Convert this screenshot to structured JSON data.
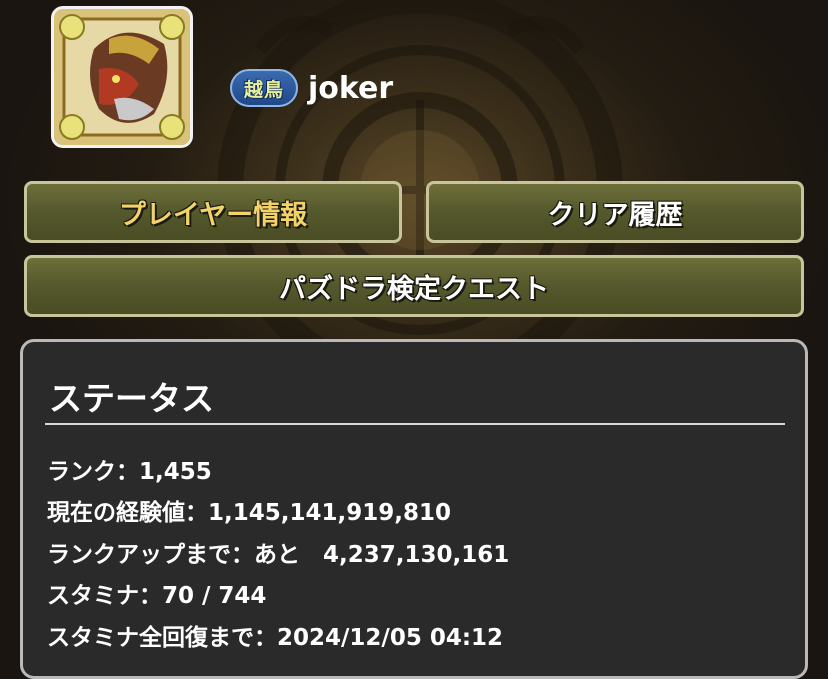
{
  "profile": {
    "badge": "越鳥",
    "name": "joker",
    "avatar_icon": "dragon-monster-icon"
  },
  "tabs": {
    "player_info": "プレイヤー情報",
    "clear_history": "クリア履歴",
    "exam_quest": "パズドラ検定クエスト"
  },
  "status": {
    "title": "ステータス",
    "rank": "ランク：1,455",
    "exp": "現在の経験値：1,145,141,919,810",
    "next_rank": "ランクアップまで：あと　4,237,130,161",
    "stamina": "スタミナ：70 / 744",
    "stamina_full": "スタミナ全回復まで：2024/12/05 04:12"
  },
  "colors": {
    "active_tab_text": "#f1d36a",
    "tab_background": "#55582c",
    "panel_background": "#2a2a2a"
  }
}
